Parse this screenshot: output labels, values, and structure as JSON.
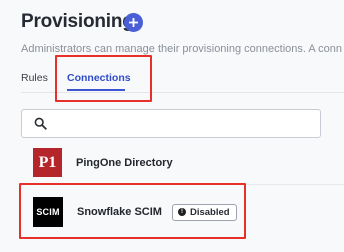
{
  "header": {
    "title": "Provisioning",
    "add_icon": "plus-icon",
    "subtitle": "Administrators can manage their provisioning connections. A conn"
  },
  "tabs": [
    {
      "label": "Rules",
      "active": false
    },
    {
      "label": "Connections",
      "active": true
    }
  ],
  "search": {
    "icon": "search-icon",
    "value": "",
    "placeholder": ""
  },
  "connections": [
    {
      "name": "PingOne Directory",
      "logo_text": "P1",
      "logo_color": "#b5262a",
      "status": ""
    },
    {
      "name": "Snowflake SCIM",
      "logo_text": "SCIM",
      "logo_color": "#000000",
      "status": "Disabled"
    }
  ],
  "colors": {
    "accent": "#3d57d3",
    "highlight": "#e8302a"
  }
}
